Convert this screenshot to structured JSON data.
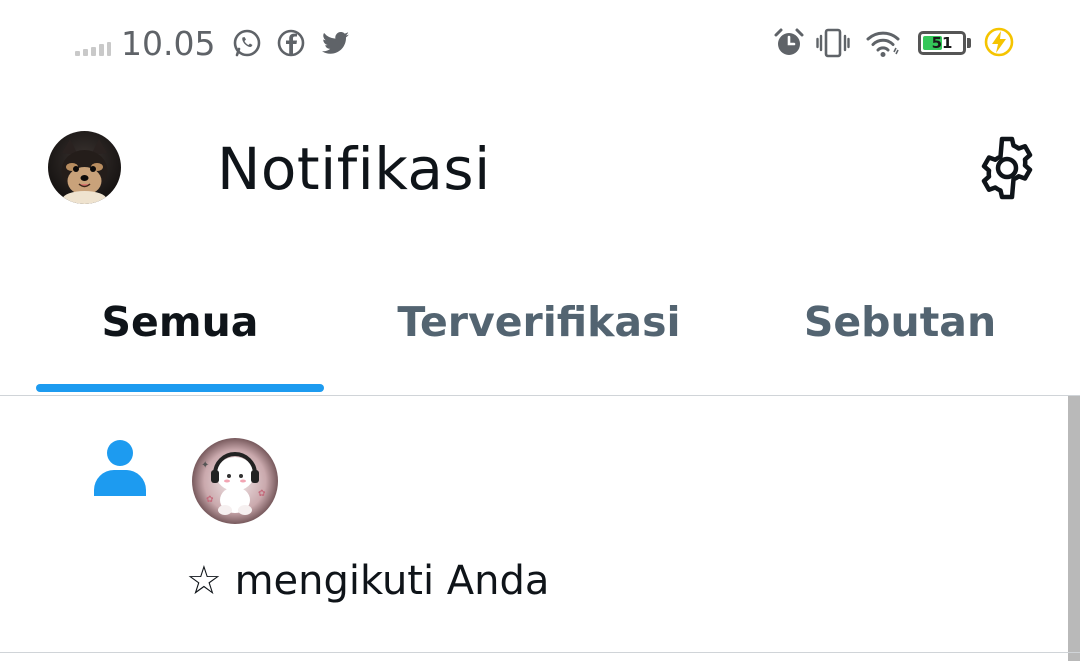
{
  "status_bar": {
    "time": "10.05",
    "battery_level": "51",
    "battery_fraction": 0.51,
    "notification_icons": [
      "whatsapp-icon",
      "facebook-icon",
      "twitter-icon"
    ],
    "system_icons": [
      "alarm-icon",
      "vibrate-icon",
      "wifi-icon",
      "battery-icon",
      "charging-icon"
    ]
  },
  "header": {
    "title": "Notifikasi",
    "avatar_icon": "profile-avatar",
    "settings_icon": "gear-icon"
  },
  "tabs": [
    {
      "label": "Semua",
      "active": true
    },
    {
      "label": "Terverifikasi",
      "active": false
    },
    {
      "label": "Sebutan",
      "active": false
    }
  ],
  "notifications": [
    {
      "type_icon": "person-icon",
      "star": "☆",
      "text": "mengikuti Anda"
    }
  ],
  "colors": {
    "accent": "#1d9bf0",
    "text_primary": "#0f1419",
    "text_secondary": "#536471",
    "battery_fill": "#34c759",
    "charging": "#f5c400"
  }
}
